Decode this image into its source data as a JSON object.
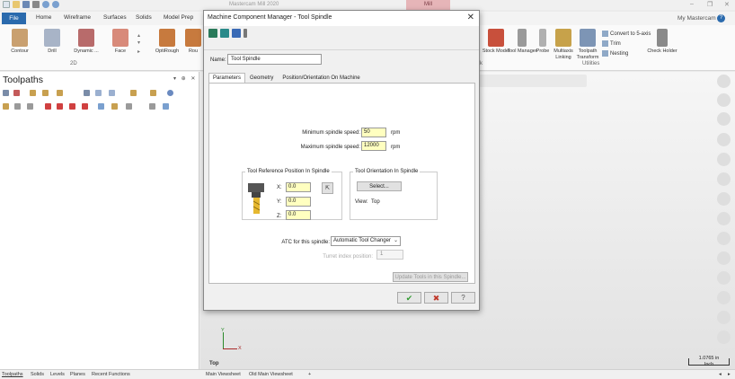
{
  "app": {
    "title": "Mastercam Mill 2020",
    "mode_badge": "Mill"
  },
  "ribbon": {
    "file_tab": "File",
    "tabs": [
      "Home",
      "Wireframe",
      "Surfaces",
      "Solids",
      "Model Prep"
    ],
    "my_mastercam": "My Mastercam",
    "help": "?",
    "buttons_2d": [
      "Contour",
      "Drill",
      "Dynamic ...",
      "Face",
      "OptiRough",
      "Rou"
    ],
    "group_2d": "2D",
    "buttons_utilities": [
      "Stock Model",
      "Tool Manager",
      "Probe",
      "Multiaxis Linking",
      "Toolpath Transform",
      "Check Holder"
    ],
    "small_items": [
      "Convert to 5-axis",
      "Trim",
      "Nesting"
    ],
    "group_utilities": "Utilities",
    "group_k": "k"
  },
  "panel": {
    "title": "Toolpaths",
    "controls": "▾ ⊕ ✕"
  },
  "bottom_tabs": [
    "Toolpaths",
    "Solids",
    "Levels",
    "Planes",
    "Recent Functions"
  ],
  "viewsheets": [
    "Main Viewsheet",
    "Old Main Viewsheet",
    "+"
  ],
  "viewport": {
    "view_name": "Top",
    "axis_x": "X",
    "axis_y": "Y",
    "scale_value": "1.0765 in",
    "scale_unit": "Inch"
  },
  "dialog": {
    "title": "Machine Component Manager - Tool Spindle",
    "close": "✕",
    "name_label": "Name:",
    "name_value": "Tool Spindle",
    "tabs": [
      "Parameters",
      "Geometry",
      "Position/Orientation On Machine"
    ],
    "min_speed_label": "Minimum spindle speed:",
    "min_speed_value": "50",
    "max_speed_label": "Maximum spindle speed:",
    "max_speed_value": "12000",
    "speed_unit": "rpm",
    "ref_group_title": "Tool Reference Position In Spindle",
    "x_label": "X:",
    "x_value": "0.0",
    "y_label": "Y:",
    "y_value": "0.0",
    "z_label": "Z:",
    "z_value": "0.0",
    "orient_group_title": "Tool Orientation In Spindle",
    "select_button": "Select...",
    "view_label": "View:",
    "view_value": "Top",
    "atc_label": "ATC for this spindle:",
    "atc_value": "Automatic Tool Changer",
    "turret_label": "Turret index position:",
    "turret_value": "1",
    "update_button": "Update Tools in this Spindle...",
    "ok_icon": "✔",
    "cancel_icon": "✖",
    "help_icon": "?"
  },
  "colors": {
    "accent": "#2a6aad",
    "required_field": "#ffffc0",
    "ok_green": "#2e9a2e",
    "cancel_red": "#c0392b"
  }
}
